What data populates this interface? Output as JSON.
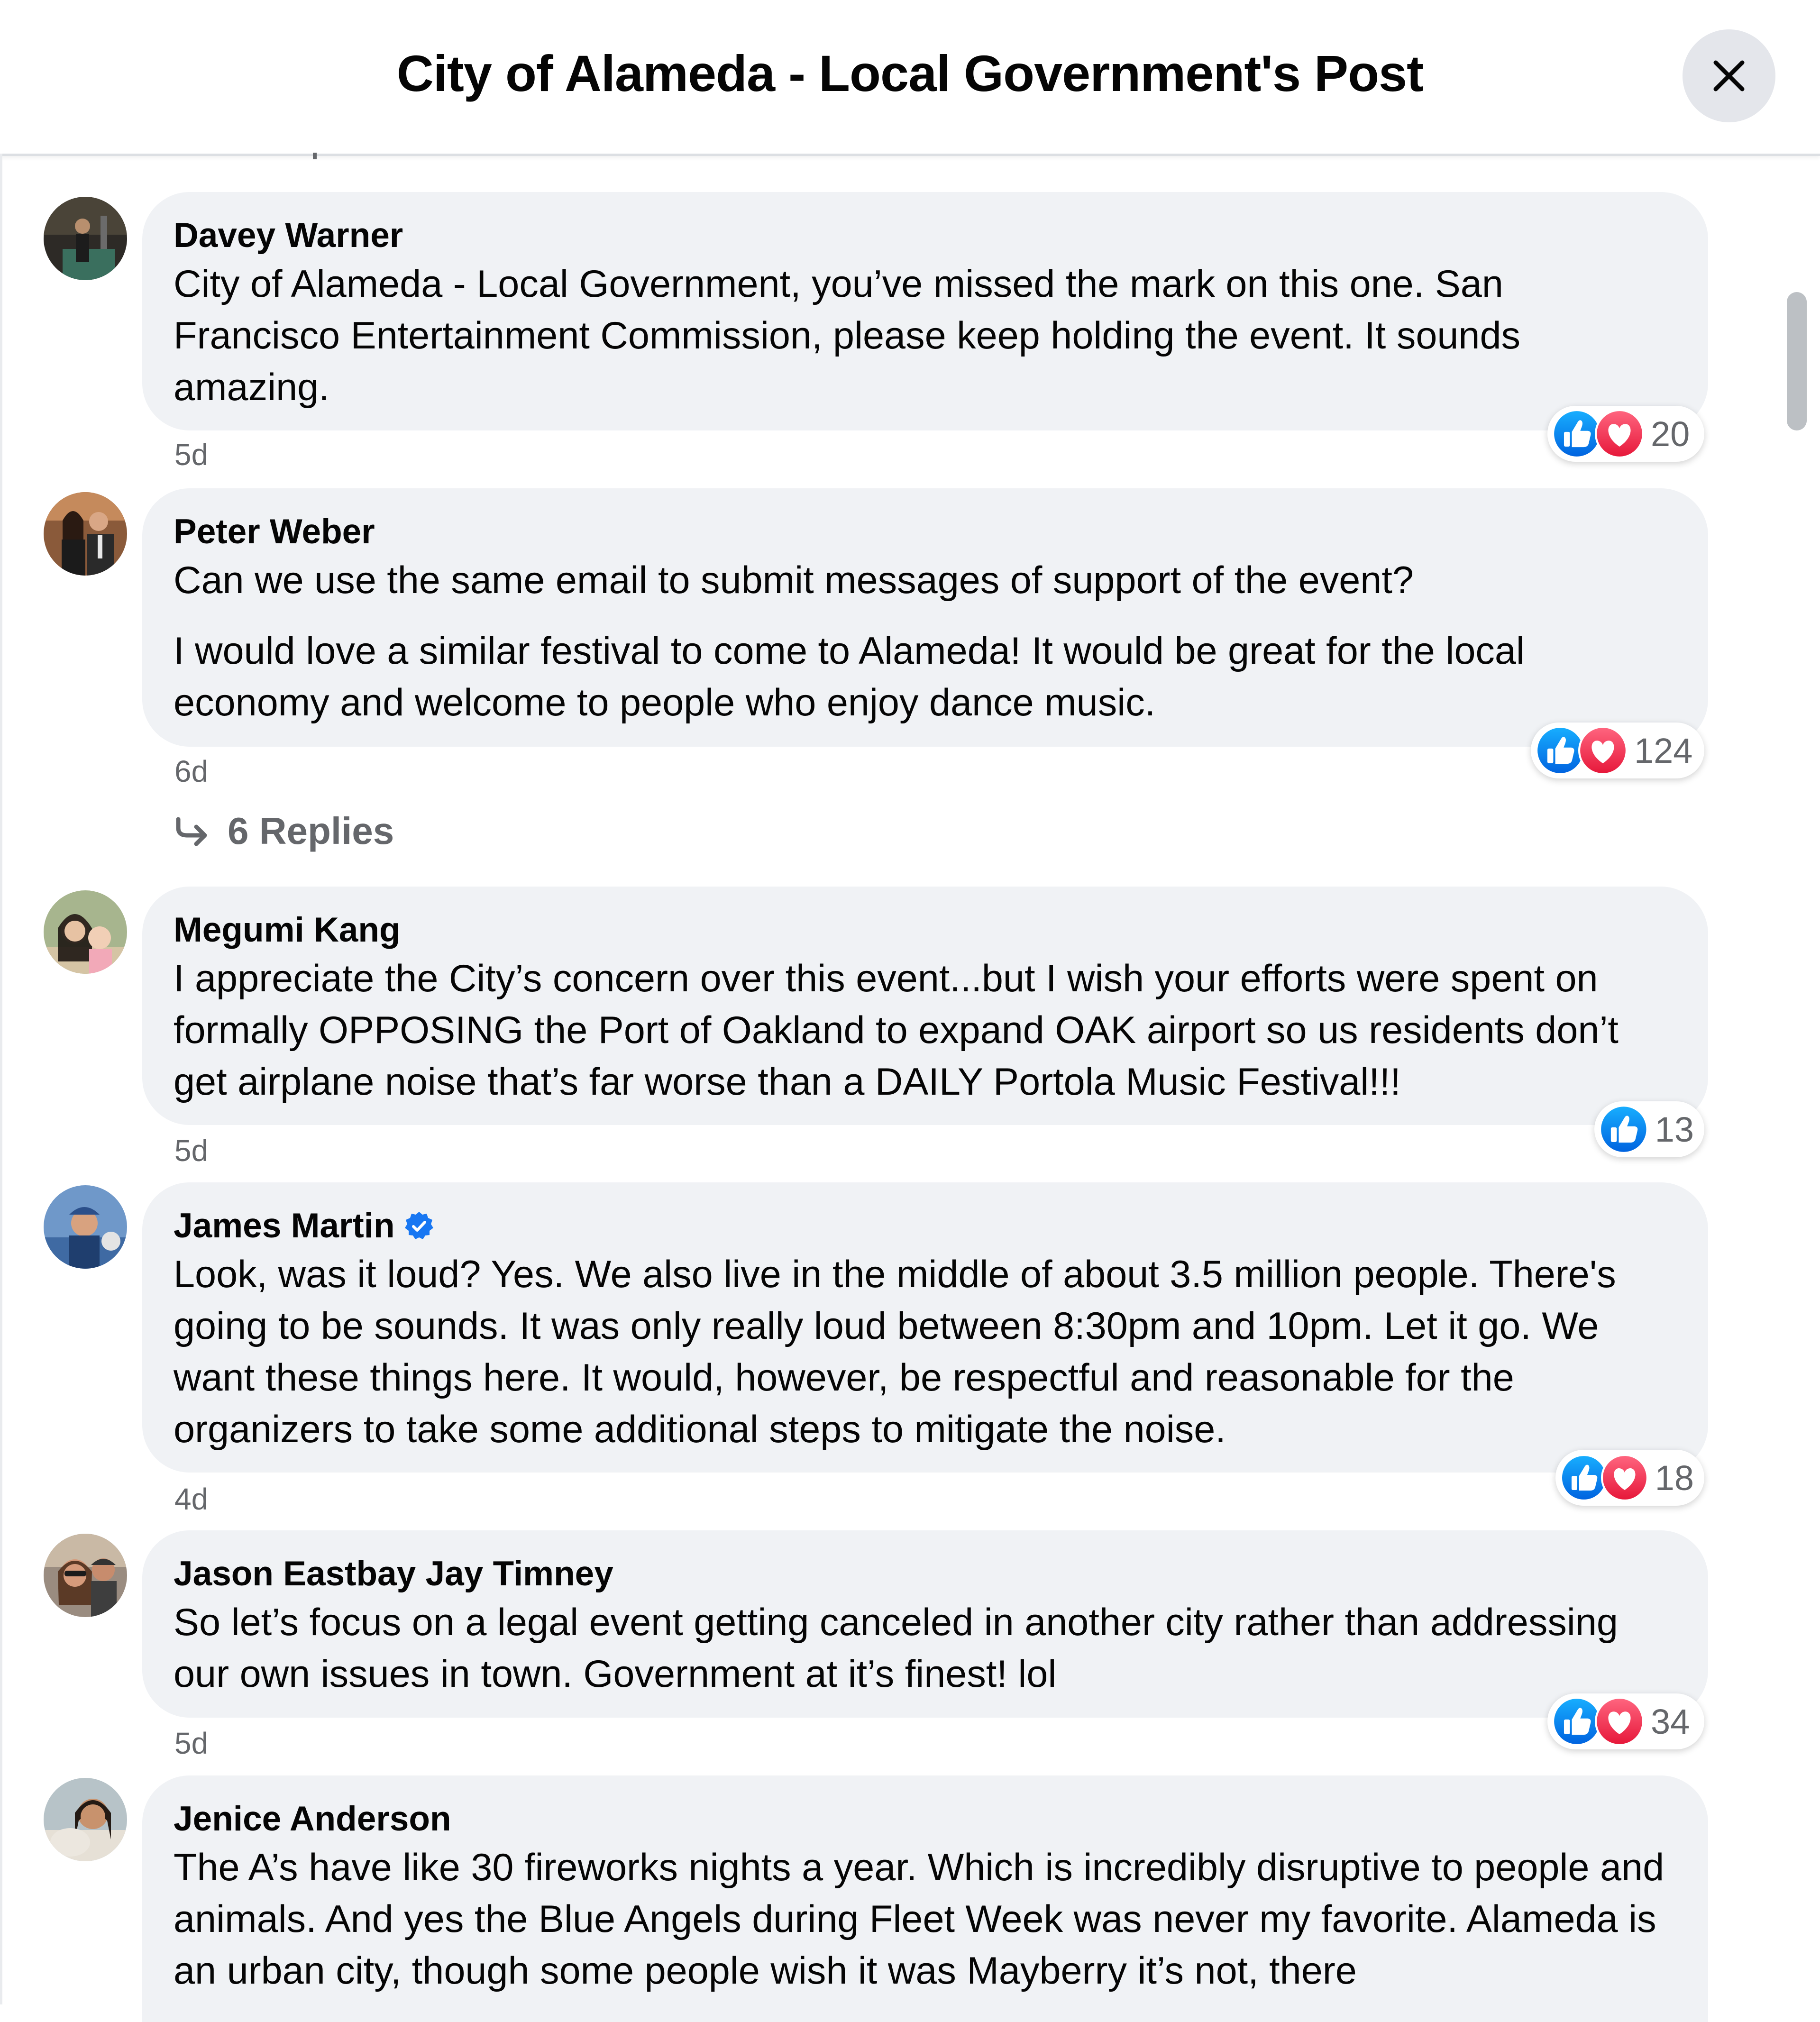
{
  "header": {
    "title": "City of Alameda - Local Government's Post"
  },
  "icons": {
    "close": "close-icon",
    "like": "like-icon",
    "love": "love-icon",
    "verified": "verified-icon",
    "reply_arrow": "reply-arrow-icon"
  },
  "colors": {
    "like": "#1877f2",
    "love": "#f33e58",
    "bubble": "#f0f2f5",
    "secondary_text": "#65676b"
  },
  "comments": [
    {
      "author": "Davey Warner",
      "text": [
        "City of Alameda - Local Government, you’ve missed the mark on this one. San Francisco Entertainment Commission, please keep holding the event. It sounds amazing."
      ],
      "time": "5d",
      "reactions": {
        "types": [
          "like",
          "love"
        ],
        "count": "20"
      }
    },
    {
      "author": "Peter Weber",
      "text": [
        "Can we use the same email to submit messages of support of the event?",
        "I would love a similar festival to come to Alameda! It would be great for the local economy and welcome to people who enjoy dance music."
      ],
      "time": "6d",
      "reactions": {
        "types": [
          "like",
          "love"
        ],
        "count": "124"
      },
      "replies_label": "6 Replies"
    },
    {
      "author": "Megumi Kang",
      "text": [
        "I appreciate the City’s concern over this event...but I wish your efforts were spent on formally OPPOSING the Port of Oakland to expand OAK airport so us residents don’t get airplane noise that’s far worse than a DAILY Portola Music Festival!!!"
      ],
      "time": "5d",
      "reactions": {
        "types": [
          "like"
        ],
        "count": "13"
      }
    },
    {
      "author": "James Martin",
      "verified": true,
      "text": [
        "Look, was it loud? Yes. We also live in the middle of about 3.5 million people. There's going to be sounds. It was only really loud between 8:30pm and 10pm. Let it go. We want these things here. It would, however, be respectful and reasonable for the organizers to take some additional steps to mitigate the noise."
      ],
      "time": "4d",
      "reactions": {
        "types": [
          "like",
          "love"
        ],
        "count": "18"
      }
    },
    {
      "author": "Jason Eastbay Jay Timney",
      "text": [
        "So let’s focus on a legal event getting canceled in another city rather than addressing our own issues in town. Government at it’s finest! lol"
      ],
      "time": "5d",
      "reactions": {
        "types": [
          "like",
          "love"
        ],
        "count": "34"
      }
    },
    {
      "author": "Jenice Anderson",
      "text": [
        "The A’s have like 30 fireworks nights a year. Which is incredibly disruptive to people and animals. And yes the Blue Angels during Fleet Week was never my favorite. Alameda is an urban city, though some people wish it was Mayberry it’s not, there"
      ]
    }
  ]
}
